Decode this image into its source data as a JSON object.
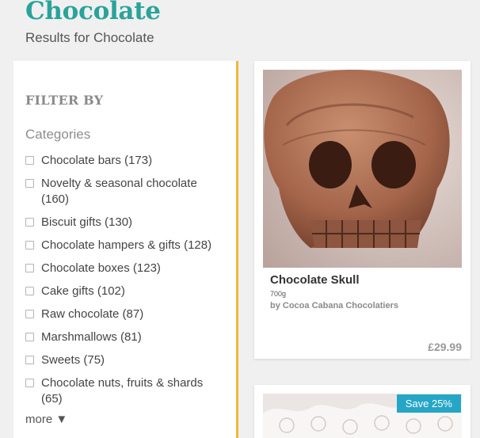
{
  "page": {
    "title": "Chocolate",
    "subtitle": "Results for Chocolate"
  },
  "filter": {
    "heading": "FILTER BY",
    "categories_heading": "Categories",
    "categories": [
      {
        "label": "Chocolate bars (173)"
      },
      {
        "label": "Novelty & seasonal chocolate (160)"
      },
      {
        "label": "Biscuit gifts (130)"
      },
      {
        "label": "Chocolate hampers & gifts (128)"
      },
      {
        "label": "Chocolate boxes (123)"
      },
      {
        "label": "Cake gifts (102)"
      },
      {
        "label": "Raw chocolate (87)"
      },
      {
        "label": "Marshmallows (81)"
      },
      {
        "label": "Sweets (75)"
      },
      {
        "label": "Chocolate nuts, fruits & shards (65)"
      }
    ],
    "more_label": "more ▼"
  },
  "products": [
    {
      "name": "Chocolate Skull",
      "weight": "700g",
      "seller": "by Cocoa Cabana Chocolatiers",
      "price": "£29.99",
      "image_icon": "chocolate-skull-image"
    },
    {
      "badge": "Save 25%",
      "image_icon": "lace-image"
    }
  ],
  "colors": {
    "title_teal": "#2aa39a",
    "panel_border": "#f0b73e",
    "badge_blue": "#26a6c7"
  }
}
